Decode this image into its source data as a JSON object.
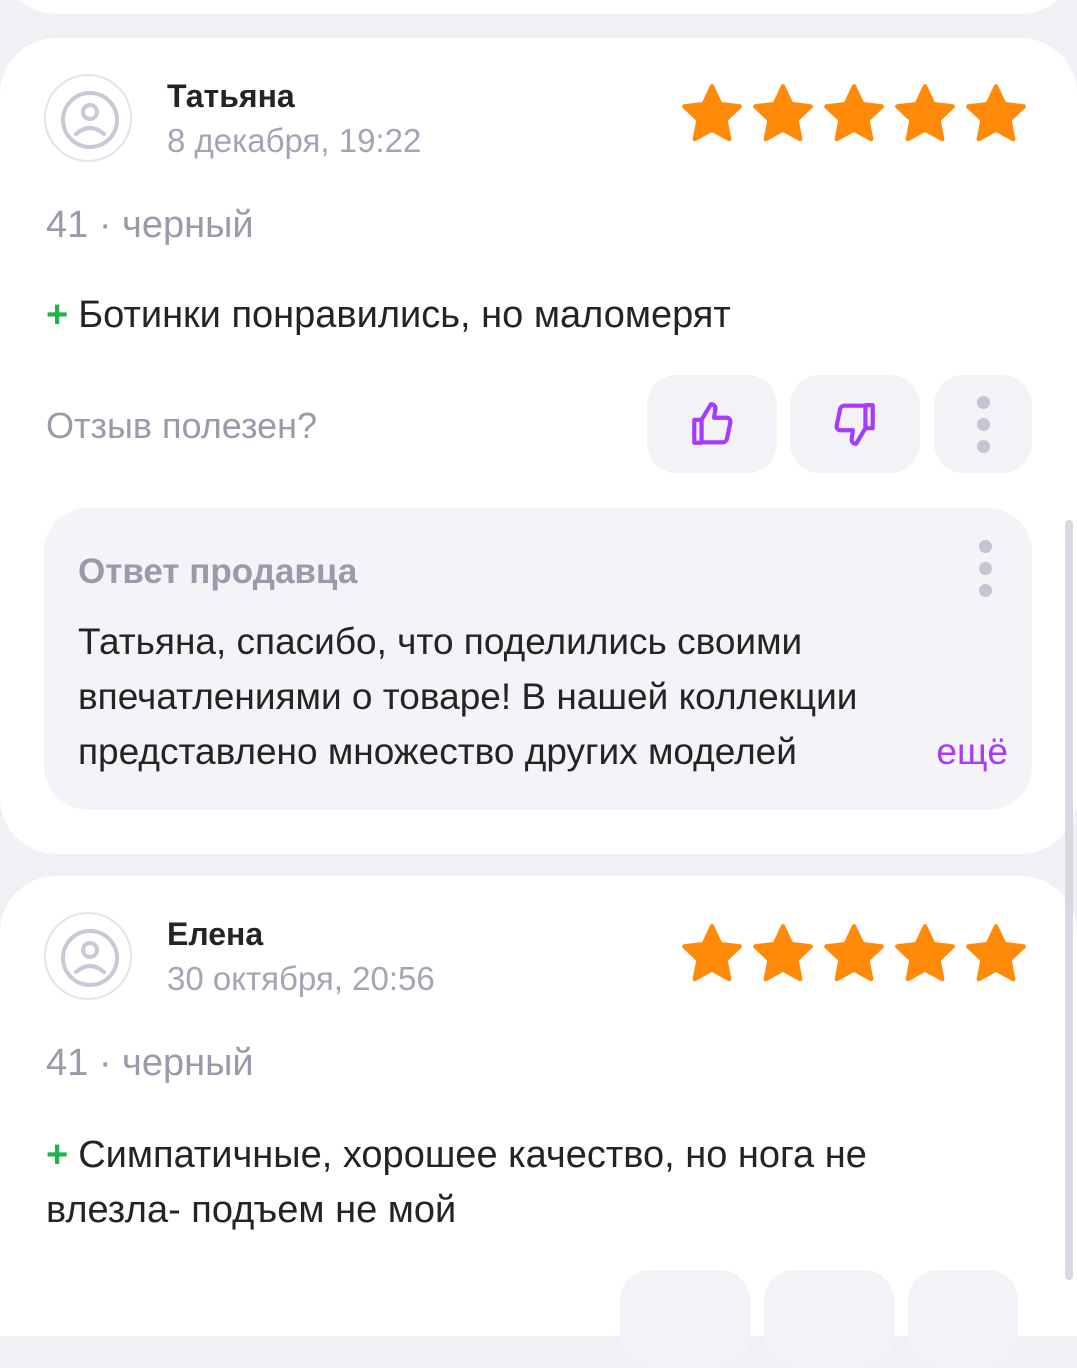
{
  "colors": {
    "star": "#ff8a0a",
    "accent": "#a73afd",
    "plus": "#22b14c"
  },
  "helpful_label": "Отзыв полезен?",
  "reviews": [
    {
      "author": "Татьяна",
      "date": "8 декабря, 19:22",
      "rating": 5,
      "variant": "41 · черный",
      "plus_sign": "+",
      "text": "Ботинки понравились, но маломерят",
      "seller_reply": {
        "title": "Ответ продавца",
        "text": "Татьяна, спасибо, что поделились своими впечатлениями о товаре! В нашей коллекции представлено множество других моделей",
        "more_label": "ещё"
      }
    },
    {
      "author": "Елена",
      "date": "30 октября, 20:56",
      "rating": 5,
      "variant": "41 · черный",
      "plus_sign": "+",
      "text": "Симпатичные, хорошее качество, но нога не влезла- подъем не мой"
    }
  ],
  "icons": {
    "avatar": "avatar-placeholder-icon",
    "like": "thumbs-up-icon",
    "dislike": "thumbs-down-icon",
    "more": "more-vertical-icon",
    "star": "star-icon"
  }
}
